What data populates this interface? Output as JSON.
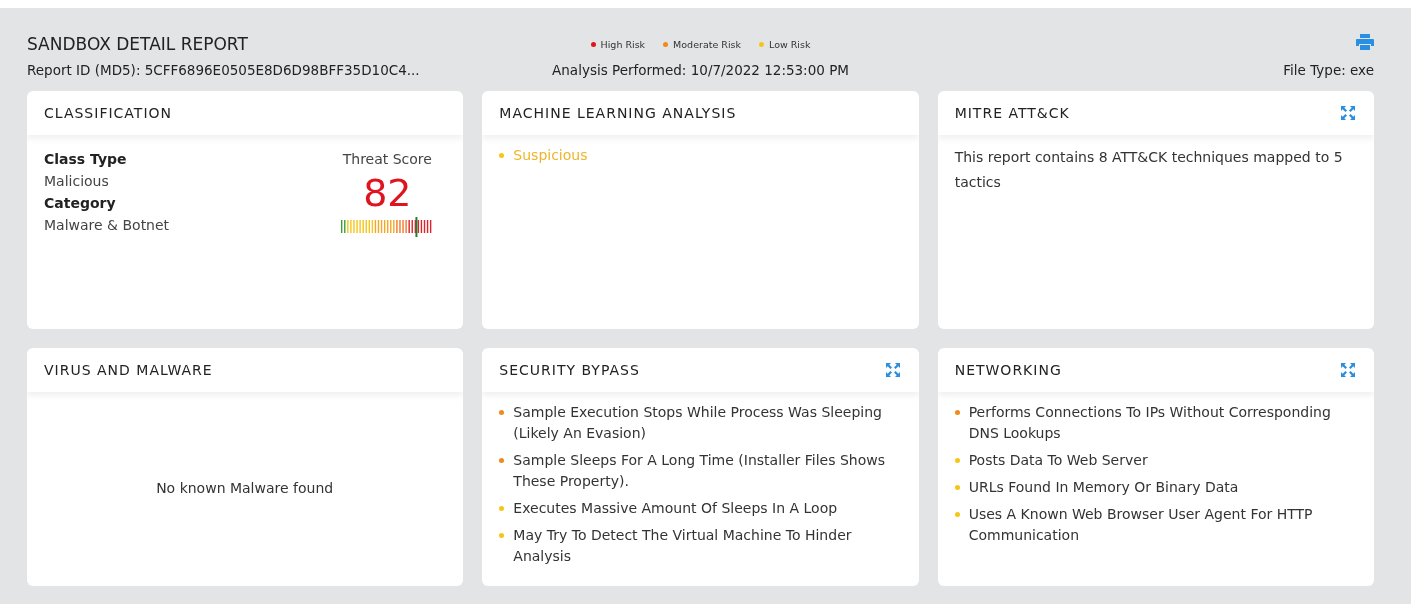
{
  "header": {
    "title": "SANDBOX DETAIL REPORT",
    "report_id": "Report ID (MD5): 5CFF6896E0505E8D6D98BFF35D10C4...",
    "analysis": "Analysis Performed: 10/7/2022 12:53:00 PM",
    "file_type": "File Type: exe"
  },
  "legend": [
    {
      "label": "High Risk",
      "color": "#e0141e"
    },
    {
      "label": "Moderate Risk",
      "color": "#f08a1c"
    },
    {
      "label": "Low Risk",
      "color": "#f5c518"
    }
  ],
  "cards": [
    {
      "kind": "classification",
      "title": "CLASSIFICATION",
      "expandable": false,
      "fields": [
        {
          "label": "Class Type",
          "value": "Malicious"
        },
        {
          "label": "Category",
          "value": "Malware & Botnet"
        }
      ],
      "score_label": "Threat Score",
      "score": "82",
      "level": 0.82
    },
    {
      "kind": "list",
      "title": "MACHINE LEARNING ANALYSIS",
      "expandable": false,
      "tinted": true,
      "items": [
        {
          "text": "Suspicious",
          "color": "#f5c518"
        }
      ]
    },
    {
      "kind": "text",
      "title": "MITRE ATT&CK",
      "expandable": true,
      "text": "This report contains 8 ATT&CK techniques mapped to 5 tactics"
    },
    {
      "kind": "message",
      "title": "VIRUS AND MALWARE",
      "expandable": false,
      "text": "No known Malware found"
    },
    {
      "kind": "list",
      "title": "SECURITY BYPASS",
      "expandable": true,
      "tinted": false,
      "items": [
        {
          "text": "Sample Execution Stops While Process Was Sleeping (Likely An Evasion)",
          "color": "#f08a1c"
        },
        {
          "text": "Sample Sleeps For A Long Time (Installer Files Shows These Property).",
          "color": "#f08a1c"
        },
        {
          "text": "Executes Massive Amount Of Sleeps In A Loop",
          "color": "#f5c518"
        },
        {
          "text": "May Try To Detect The Virtual Machine To Hinder Analysis",
          "color": "#f5c518"
        }
      ]
    },
    {
      "kind": "list",
      "title": "NETWORKING",
      "expandable": true,
      "tinted": false,
      "items": [
        {
          "text": "Performs Connections To IPs Without Corresponding DNS Lookups",
          "color": "#f08a1c"
        },
        {
          "text": "Posts Data To Web Server",
          "color": "#f5c518"
        },
        {
          "text": "URLs Found In Memory Or Binary Data",
          "color": "#f5c518"
        },
        {
          "text": "Uses A Known Web Browser User Agent For HTTP Communication",
          "color": "#f5c518"
        }
      ]
    }
  ]
}
